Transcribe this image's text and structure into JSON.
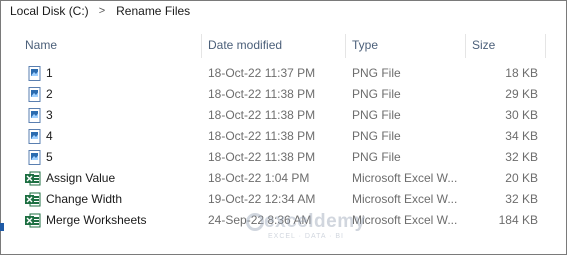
{
  "breadcrumb": {
    "items": [
      "Local Disk (C:)",
      "Rename Files"
    ],
    "separator": ">"
  },
  "columns": {
    "name": "Name",
    "date": "Date modified",
    "type": "Type",
    "size": "Size"
  },
  "files": [
    {
      "name": "1",
      "date": "18-Oct-22 11:37 PM",
      "type": "PNG File",
      "size": "18 KB",
      "icon": "png-file-icon"
    },
    {
      "name": "2",
      "date": "18-Oct-22 11:38 PM",
      "type": "PNG File",
      "size": "29 KB",
      "icon": "png-file-icon"
    },
    {
      "name": "3",
      "date": "18-Oct-22 11:38 PM",
      "type": "PNG File",
      "size": "30 KB",
      "icon": "png-file-icon"
    },
    {
      "name": "4",
      "date": "18-Oct-22 11:38 PM",
      "type": "PNG File",
      "size": "34 KB",
      "icon": "png-file-icon"
    },
    {
      "name": "5",
      "date": "18-Oct-22 11:38 PM",
      "type": "PNG File",
      "size": "32 KB",
      "icon": "png-file-icon"
    },
    {
      "name": "Assign Value",
      "date": "18-Oct-22 1:04 PM",
      "type": "Microsoft Excel W...",
      "size": "20 KB",
      "icon": "excel-file-icon"
    },
    {
      "name": "Change Width",
      "date": "19-Oct-22 12:34 AM",
      "type": "Microsoft Excel W...",
      "size": "32 KB",
      "icon": "excel-file-icon"
    },
    {
      "name": "Merge Worksheets",
      "date": "24-Sep-22 8:36 AM",
      "type": "Microsoft Excel W...",
      "size": "184 KB",
      "icon": "excel-file-icon"
    }
  ],
  "watermark": {
    "title": "exceldemy",
    "subtitle": "EXCEL · DATA · BI"
  },
  "colors": {
    "header_text": "#4c607a",
    "excel_green": "#1d6f42",
    "png_blue": "#2b6cb0"
  }
}
